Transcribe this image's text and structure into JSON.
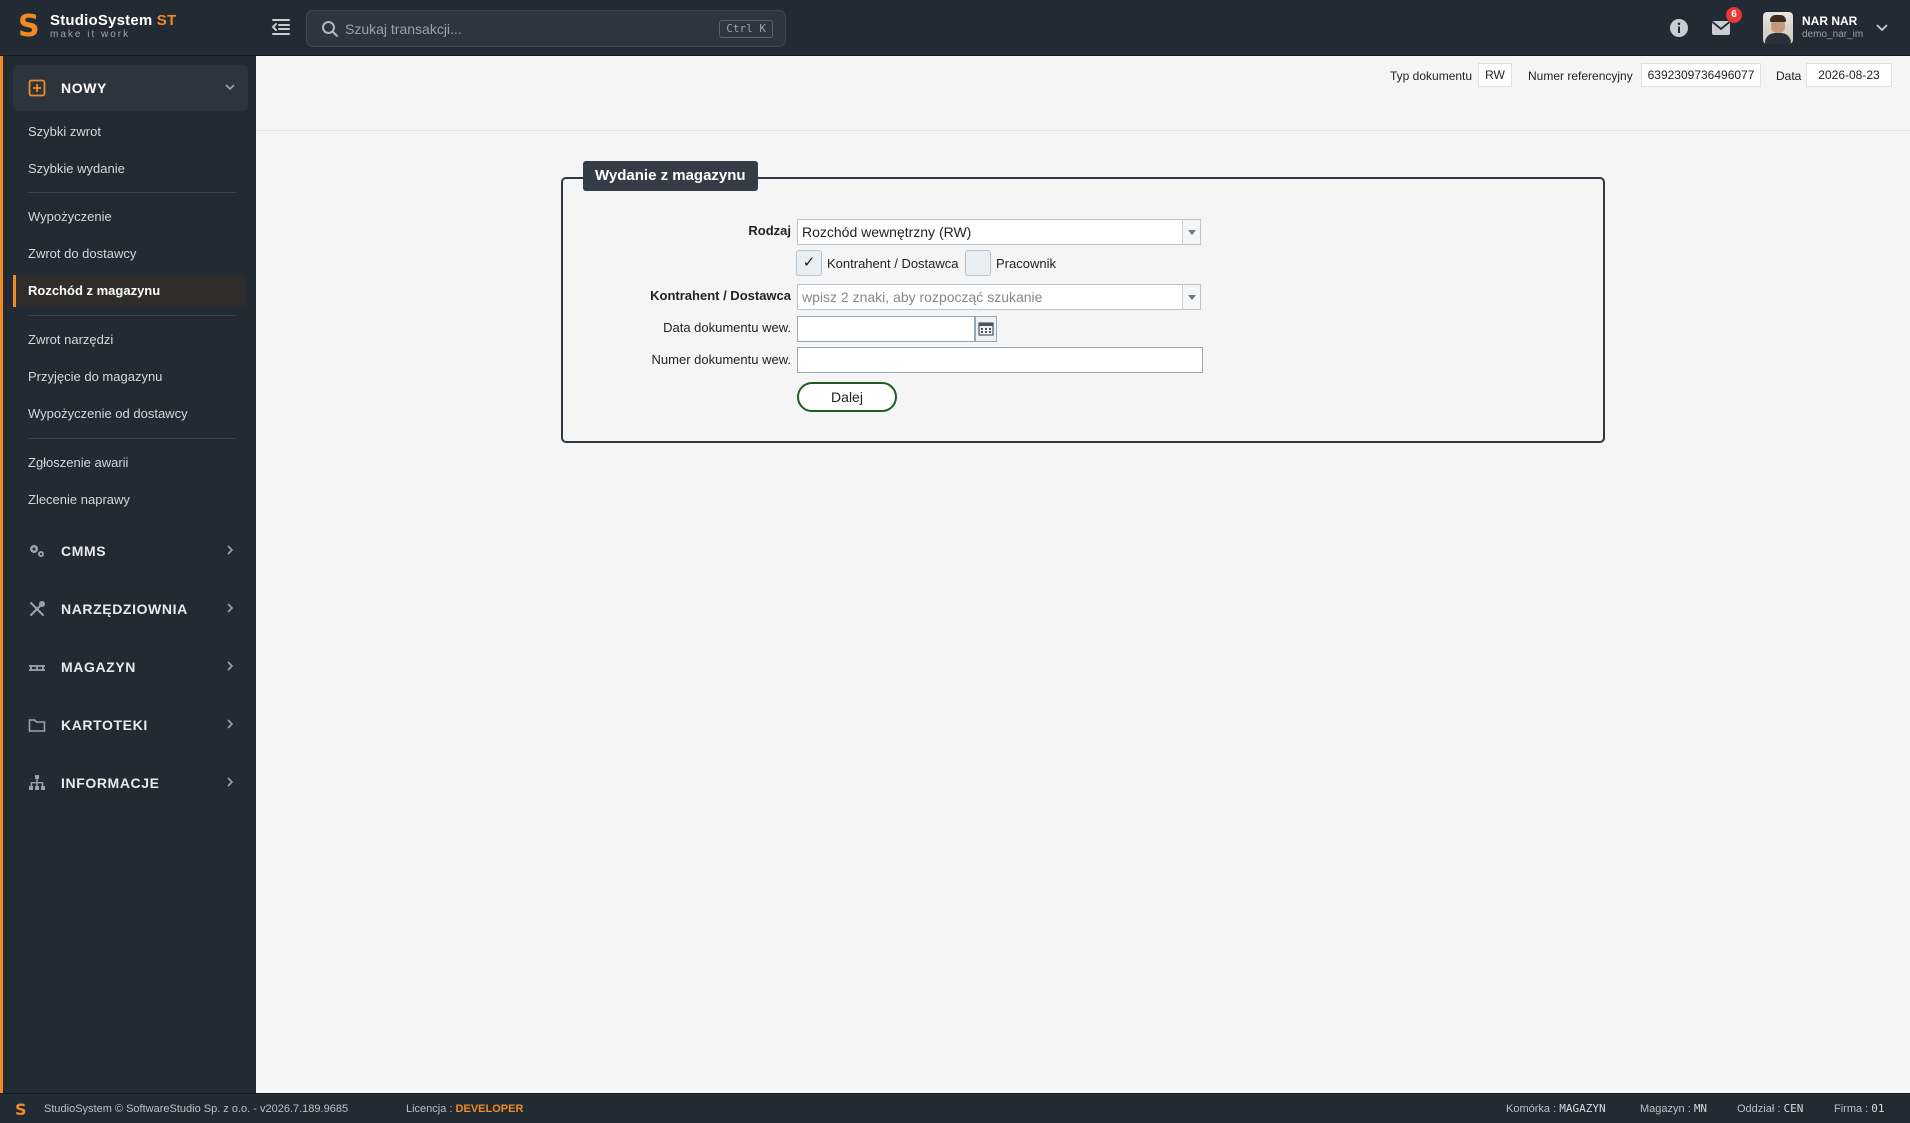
{
  "app": {
    "name": "StudioSystem",
    "name_suffix": "ST",
    "tagline": "make it work",
    "logo_letter": "S"
  },
  "search": {
    "placeholder": "Szukaj transakcji...",
    "shortcut": "Ctrl K"
  },
  "notifications": {
    "count": "6"
  },
  "user": {
    "name": "NAR NAR",
    "login": "demo_nar_im"
  },
  "sidebar": {
    "sections": [
      {
        "label": "NOWY",
        "icon": "plus-square-icon",
        "expanded": true
      },
      {
        "label": "CMMS",
        "icon": "gears-icon",
        "expanded": false
      },
      {
        "label": "NARZĘDZIOWNIA",
        "icon": "tools-icon",
        "expanded": false
      },
      {
        "label": "MAGAZYN",
        "icon": "warehouse-rack-icon",
        "expanded": false
      },
      {
        "label": "KARTOTEKI",
        "icon": "folder-icon",
        "expanded": false
      },
      {
        "label": "INFORMACJE",
        "icon": "sitemap-icon",
        "expanded": false
      }
    ],
    "items": [
      "Szybki zwrot",
      "Szybkie wydanie",
      "Wypożyczenie",
      "Zwrot do dostawcy",
      "Rozchód z magazynu",
      "Zwrot narzędzi",
      "Przyjęcie do magazynu",
      "Wypożyczenie od dostawcy",
      "Zgłoszenie awarii",
      "Zlecenie naprawy"
    ],
    "active_item": "Rozchód z magazynu"
  },
  "doc": {
    "type_label": "Typ dokumentu",
    "type_value": "RW",
    "ref_label": "Numer referencyjny",
    "ref_value": "6392309736496077",
    "date_label": "Data",
    "date_value": "2026-08-23"
  },
  "form": {
    "title": "Wydanie z magazynu",
    "rodzaj_label": "Rodzaj",
    "rodzaj_value": "Rozchód wewnętrzny (RW)",
    "check_kontrahent_label": "Kontrahent / Dostawca",
    "check_kontrahent_checked": true,
    "check_kontrahent_mark": "✓",
    "check_pracownik_label": "Pracownik",
    "check_pracownik_checked": false,
    "kontrahent_label": "Kontrahent / Dostawca",
    "kontrahent_placeholder": "wpisz 2 znaki, aby rozpocząć szukanie",
    "data_label": "Data dokumentu wew.",
    "data_value": "",
    "numer_label": "Numer dokumentu wew.",
    "numer_value": "",
    "submit_label": "Dalej"
  },
  "status": {
    "copyright": "StudioSystem © SoftwareStudio Sp. z o.o. - v2026.7.189.9685",
    "license_label": "Licencja :",
    "license_value": "DEVELOPER",
    "komorka_label": "Komórka :",
    "komorka_value": "MAGAZYN",
    "magazyn_label": "Magazyn :",
    "magazyn_value": "MN",
    "oddzial_label": "Oddział :",
    "oddzial_value": "CEN",
    "firma_label": "Firma :",
    "firma_value": "01"
  },
  "colors": {
    "accent": "#f08a24",
    "dark": "#222a33",
    "button_border": "#1e5e23",
    "badge": "#e53935"
  }
}
